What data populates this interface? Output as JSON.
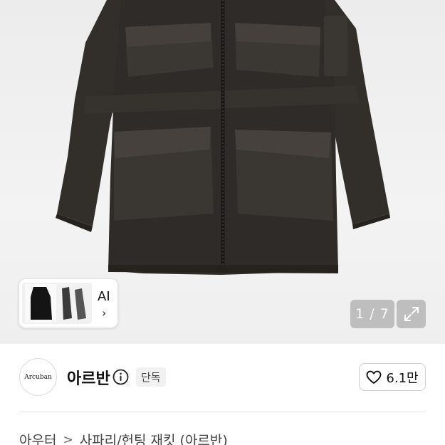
{
  "gallery": {
    "ai_label": "AI",
    "ai_chevron": "›",
    "counter": "1 / 7",
    "expand_icon": "expand-icon"
  },
  "seller": {
    "logo_text": "Arcuban",
    "name": "아르반",
    "badge": "단독",
    "like_count": "6.1만"
  },
  "breadcrumb": {
    "items": [
      "아우터",
      "사파리/헌팅 재킷 (아르반)"
    ],
    "separator": ">"
  },
  "colors": {
    "jacket": "#2d2a27",
    "counter_bg": "#a0a0a0"
  }
}
